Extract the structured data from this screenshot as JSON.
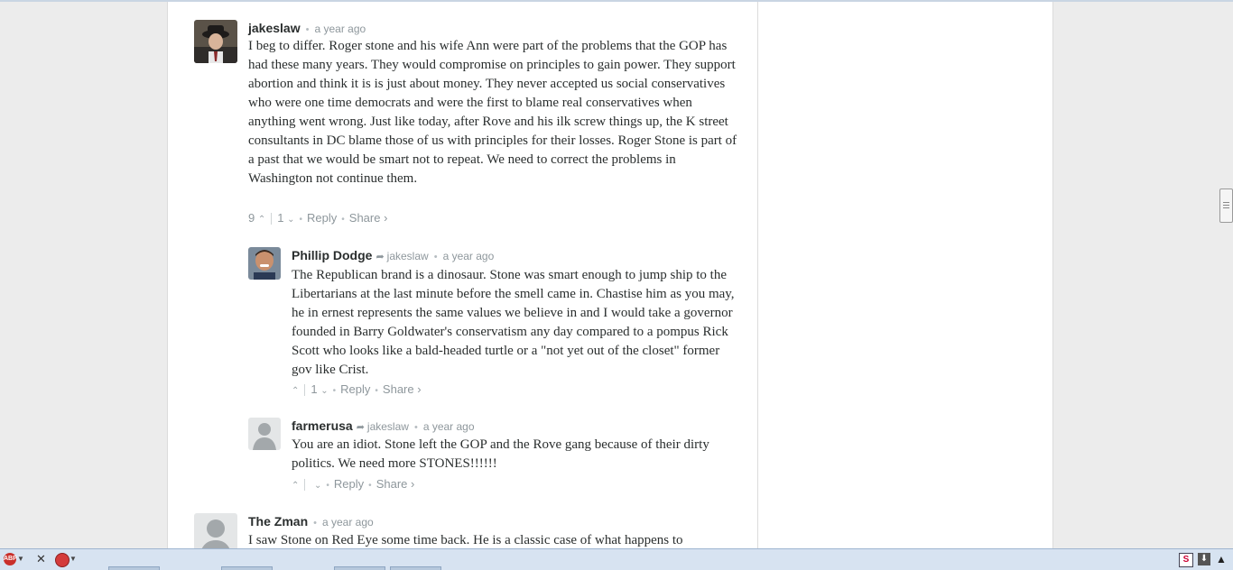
{
  "comments": [
    {
      "author": "jakeslaw",
      "time": "a year ago",
      "body": "I beg to differ. Roger stone and his wife Ann were part of the problems that the GOP has had these many years. They would compromise on principles to gain power. They support abortion and think it is is just about money. They never accepted us social conservatives who were one time democrats and were the first to blame real conservatives when anything went wrong. Just like today, after Rove and his ilk screw things up, the K street consultants in DC blame those of us with principles for their losses. Roger Stone is part of a past that we would be smart not to repeat. We need to correct the problems in Washington not continue them.",
      "upvotes": "9",
      "downvotes": "1",
      "reply_label": "Reply",
      "share_label": "Share ›"
    },
    {
      "author": "Phillip Dodge",
      "in_reply_to": "jakeslaw",
      "time": "a year ago",
      "body": "The Republican brand is a dinosaur. Stone was smart enough to jump ship to the Libertarians at the last minute before the smell came in. Chastise him as you may, he in ernest represents the same values we believe in and I would take a governor founded in Barry Goldwater's conservatism any day compared to a pompus Rick Scott who looks like a bald-headed turtle or a \"not yet out of the closet\" former gov like Crist.",
      "upvotes": "",
      "downvotes": "1",
      "reply_label": "Reply",
      "share_label": "Share ›"
    },
    {
      "author": "farmerusa",
      "in_reply_to": "jakeslaw",
      "time": "a year ago",
      "body": "You are an idiot. Stone left the GOP and the Rove gang because of their dirty politics. We need more STONES!!!!!!",
      "upvotes": "",
      "downvotes": "",
      "reply_label": "Reply",
      "share_label": "Share ›"
    },
    {
      "author": "The Zman",
      "time": "a year ago",
      "body": "I saw Stone on Red Eye some time back. He is a classic case of what happens to"
    }
  ],
  "statusbar": {
    "abp_label": "ABP",
    "s_label": "S",
    "download_icon": "download-arrow-icon",
    "up_icon": "up-triangle-icon"
  }
}
